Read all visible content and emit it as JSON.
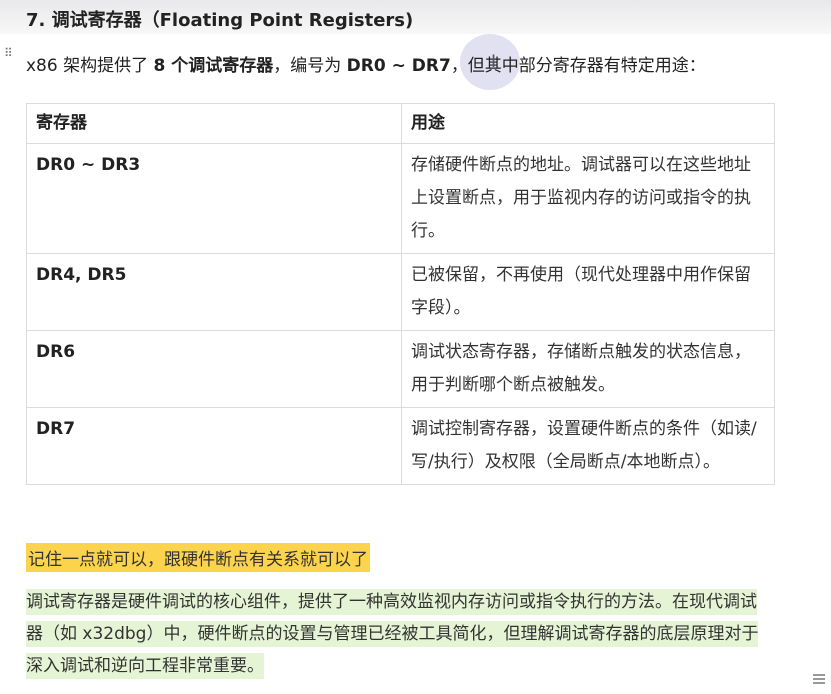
{
  "heading": "7. 调试寄存器（Floating Point Registers)",
  "intro": {
    "text1": "x86 架构提供了 ",
    "bold1": "8 个调试寄存器",
    "text2": "，编号为 ",
    "bold2": "DR0 ~ DR7",
    "text3": "，但其中部分寄存器有特定用途："
  },
  "table": {
    "headers": [
      "寄存器",
      "用途"
    ],
    "rows": [
      {
        "name": "DR0 ~ DR3",
        "use": "存储硬件断点的地址。调试器可以在这些地址上设置断点，用于监视内存的访问或指令的执行。"
      },
      {
        "name": "DR4, DR5",
        "use": "已被保留，不再使用（现代处理器中用作保留字段）。"
      },
      {
        "name": "DR6",
        "use": "调试状态寄存器，存储断点触发的状态信息，用于判断哪个断点被触发。"
      },
      {
        "name": "DR7",
        "use": "调试控制寄存器，设置硬件断点的条件（如读/写/执行）及权限（全局断点/本地断点）。"
      }
    ]
  },
  "note": "记住一点就可以，跟硬件断点有关系就可以了",
  "summary": "调试寄存器是硬件调试的核心组件，提供了一种高效监视内存访问或指令执行的方法。在现代调试器（如 x32dbg）中，硬件断点的设置与管理已经被工具简化，但理解调试寄存器的底层原理对于深入调试和逆向工程非常重要。",
  "icons": {
    "drag": "drag-handle-icon",
    "cursor": "text-cursor-icon",
    "corner": "floating-tool-icon"
  },
  "colors": {
    "note_highlight": "#fcd34d",
    "summary_highlight": "#e4f4d4",
    "table_border": "#dcdcdc"
  }
}
